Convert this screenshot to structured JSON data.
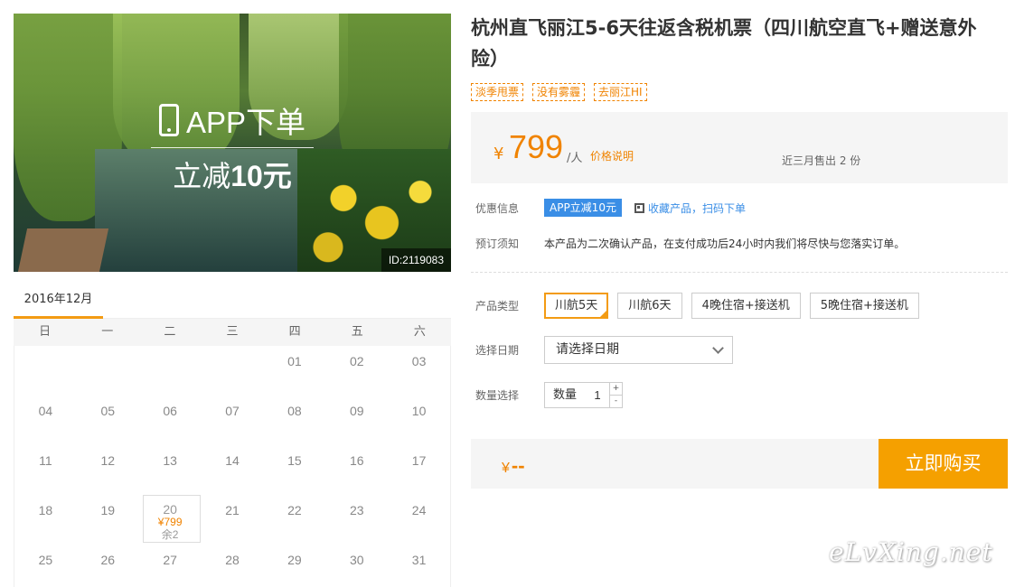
{
  "hero": {
    "app_text": "APP下单",
    "discount_prefix": "立减",
    "discount_amount": "10元",
    "id_tag": "ID:2119083"
  },
  "calendar": {
    "month": "2016年12月",
    "weekdays": [
      "日",
      "一",
      "二",
      "三",
      "四",
      "五",
      "六"
    ],
    "weeks": [
      [
        "",
        "",
        "",
        "",
        "01",
        "02",
        "03"
      ],
      [
        "04",
        "05",
        "06",
        "07",
        "08",
        "09",
        "10"
      ],
      [
        "11",
        "12",
        "13",
        "14",
        "15",
        "16",
        "17"
      ],
      [
        "18",
        "19",
        "20",
        "21",
        "22",
        "23",
        "24"
      ],
      [
        "25",
        "26",
        "27",
        "28",
        "29",
        "30",
        "31"
      ]
    ],
    "available_day": {
      "day": "20",
      "price": "¥799",
      "remaining": "余2"
    }
  },
  "product": {
    "title": "杭州直飞丽江5-6天往返含税机票（四川航空直飞+赠送意外险）",
    "tags": [
      "淡季甩票",
      "没有雾霾",
      "去丽江HI"
    ]
  },
  "price": {
    "currency": "¥",
    "amount": "799",
    "unit": "/人",
    "explain_link": "价格说明",
    "sold": "近三月售出 2 份"
  },
  "promo": {
    "label": "优惠信息",
    "badge": "APP立减10元",
    "qr_link": "收藏产品，扫码下单"
  },
  "notice": {
    "label": "预订须知",
    "text": "本产品为二次确认产品，在支付成功后24小时内我们将尽快与您落实订单。"
  },
  "options": {
    "type_label": "产品类型",
    "types": [
      "川航5天",
      "川航6天",
      "4晚住宿+接送机",
      "5晚住宿+接送机"
    ],
    "selected_type": "川航5天",
    "date_label": "选择日期",
    "date_placeholder": "请选择日期",
    "qty_label": "数量选择",
    "qty_inner_label": "数量",
    "qty_value": "1",
    "qty_plus": "+",
    "qty_minus": "-"
  },
  "buy": {
    "currency": "¥",
    "total": "--",
    "button": "立即购买"
  },
  "watermark": "eLvXing.net",
  "colors": {
    "accent": "#f08300",
    "button": "#f5a000",
    "promo_badge": "#3a8ee6",
    "tab_underline": "#f39b13"
  }
}
